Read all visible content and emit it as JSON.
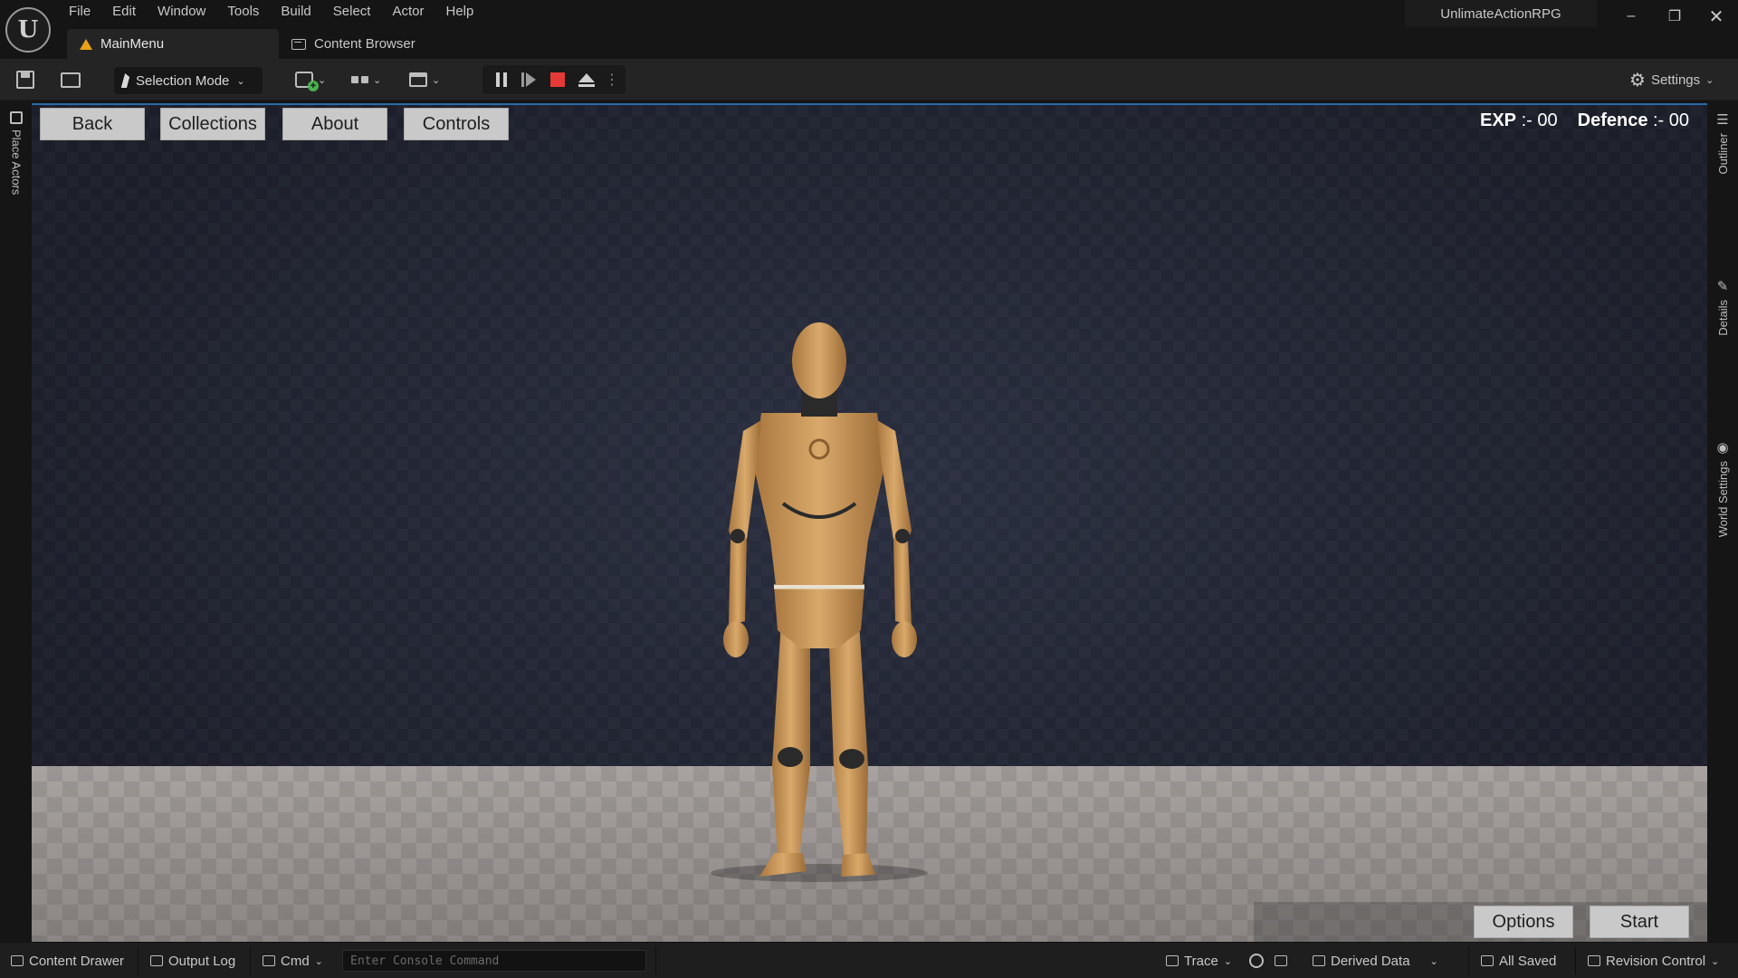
{
  "app": {
    "logo_text": "U",
    "project_name": "UnlimateActionRPG",
    "window_controls": {
      "minimize": "–",
      "restore": "❐",
      "close": "✕"
    }
  },
  "menu": [
    "File",
    "Edit",
    "Window",
    "Tools",
    "Build",
    "Select",
    "Actor",
    "Help"
  ],
  "tabs": [
    {
      "label": "MainMenu",
      "icon": "level-icon",
      "active": true
    },
    {
      "label": "Content Browser",
      "icon": "content-browser-icon",
      "active": false
    }
  ],
  "toolbar": {
    "selection_mode": "Selection Mode",
    "chevron": "⌄",
    "more": "⋮",
    "settings": "Settings",
    "gear": "⚙",
    "add_plus": "+"
  },
  "side_tabs": {
    "left": "Place Actors",
    "outliner": "Outliner",
    "details": "Details",
    "world_settings": "World Settings",
    "outliner_icon": "☰",
    "details_icon": "✎",
    "world_icon": "◉"
  },
  "game_ui": {
    "buttons": {
      "back": "Back",
      "collections": "Collections",
      "about": "About",
      "controls": "Controls",
      "options": "Options",
      "start": "Start"
    },
    "stats": [
      {
        "label": "EXP",
        "value": ":- 00"
      },
      {
        "label": "Defence",
        "value": ":- 00"
      }
    ]
  },
  "statusbar": {
    "content_drawer": "Content Drawer",
    "output_log": "Output Log",
    "cmd": "Cmd",
    "console_placeholder": "Enter Console Command",
    "trace": "Trace",
    "derived_data": "Derived Data",
    "all_saved": "All Saved",
    "revision_control": "Revision Control"
  },
  "colors": {
    "accent_blue": "#2b6aa8",
    "stop_red": "#e53935",
    "level_orange": "#e8a317",
    "mannequin_skin": "#c7955a"
  }
}
